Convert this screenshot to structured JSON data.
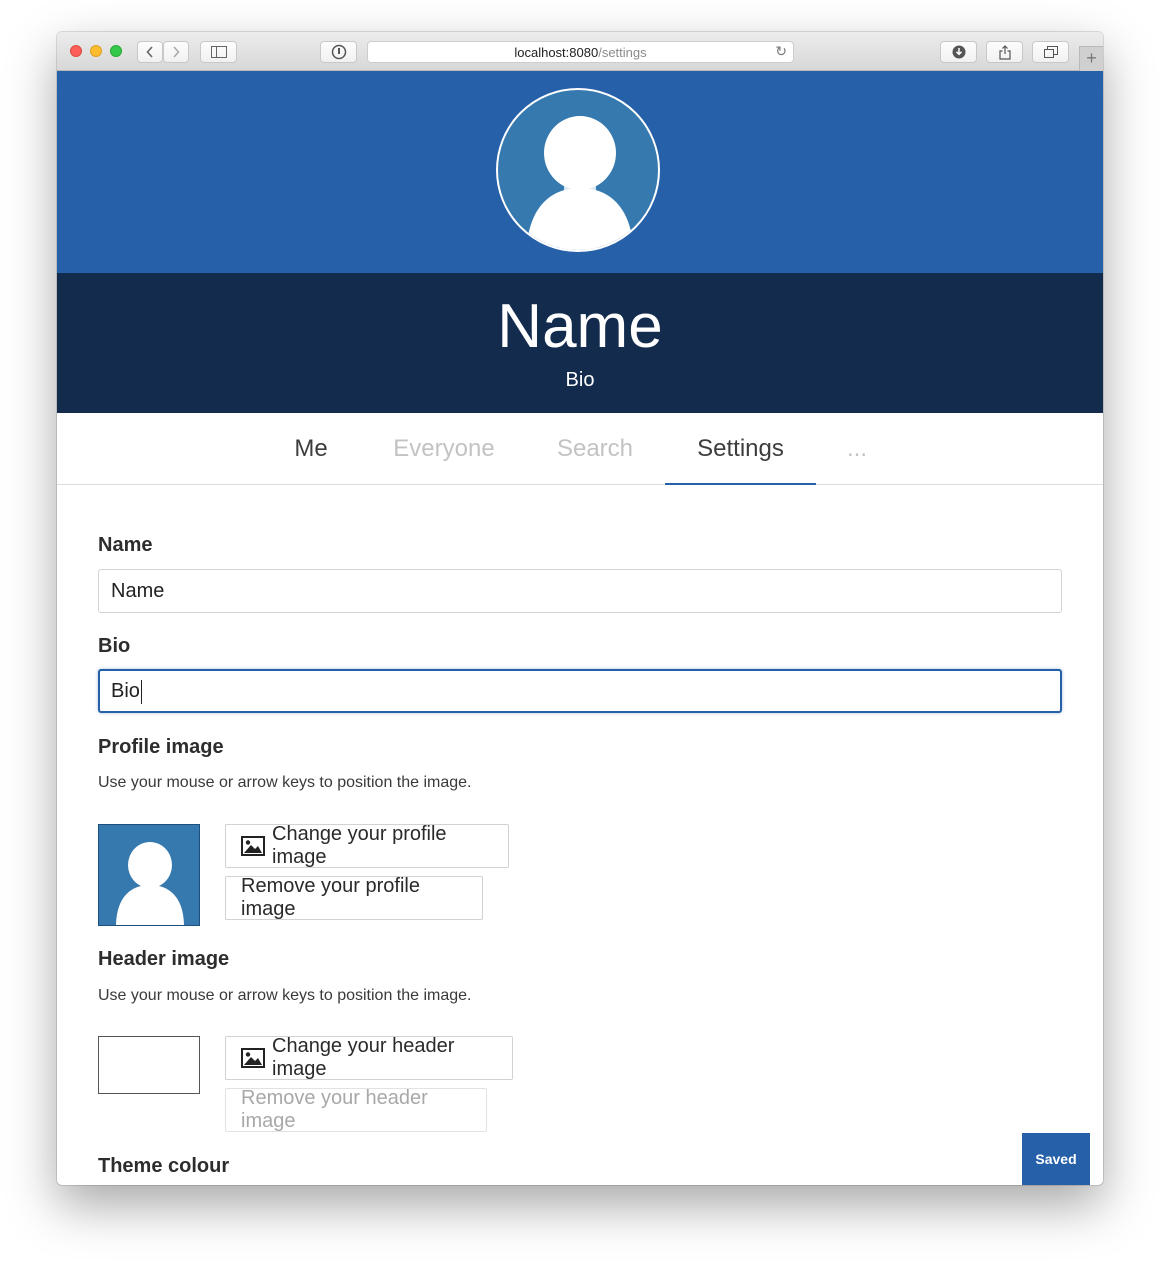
{
  "browser": {
    "url_host": "localhost:8080",
    "url_path": "/settings"
  },
  "profile": {
    "name": "Name",
    "bio": "Bio"
  },
  "tabs": [
    {
      "label": "Me"
    },
    {
      "label": "Everyone"
    },
    {
      "label": "Search"
    },
    {
      "label": "Settings"
    },
    {
      "label": "..."
    }
  ],
  "form": {
    "name_label": "Name",
    "name_value": "Name",
    "bio_label": "Bio",
    "bio_value": "Bio",
    "profile_image": {
      "label": "Profile image",
      "help": "Use your mouse or arrow keys to position the image.",
      "change_label": "Change your profile image",
      "remove_label": "Remove your profile image"
    },
    "header_image": {
      "label": "Header image",
      "help": "Use your mouse or arrow keys to position the image.",
      "change_label": "Change your header image",
      "remove_label": "Remove your header image"
    },
    "theme_label": "Theme colour"
  },
  "status": {
    "saved_label": "Saved"
  },
  "colors": {
    "primary": "#2660a9",
    "namebar": "#132b4d",
    "avatar_bg": "#3679ae"
  }
}
